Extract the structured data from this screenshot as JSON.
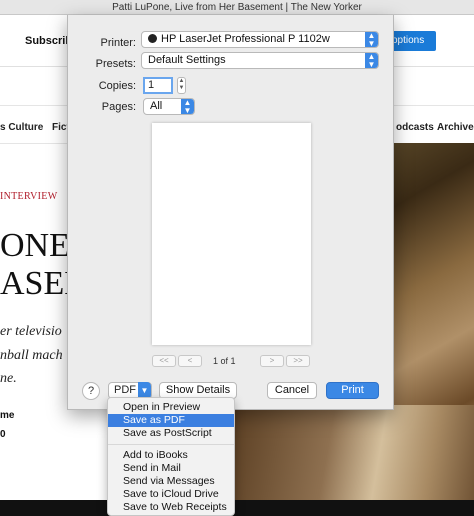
{
  "window": {
    "title": "Patti LuPone, Live from Her Basement | The New Yorker"
  },
  "webpage": {
    "subscribe_label": "Subscribe",
    "options_label": "options",
    "nav": {
      "left_item": "s Culture",
      "fict_item": "Ficti",
      "podcasts_item": "odcasts",
      "archive_item": "Archive"
    },
    "kicker": "INTERVIEW",
    "headline_line1": "ONE, I",
    "headline_line2": "ASEN",
    "dek_line1": "er televisio",
    "dek_line2": "nball mach",
    "dek_line3": "ne.",
    "byline_name": "me",
    "byline_date": "0"
  },
  "print_dialog": {
    "printer_label": "Printer:",
    "printer_value": "HP LaserJet Professional P 1102w",
    "presets_label": "Presets:",
    "presets_value": "Default Settings",
    "copies_label": "Copies:",
    "copies_value": "1",
    "pages_label": "Pages:",
    "pages_value": "All",
    "page_indicator": "1 of 1",
    "first_page_symbol": "<<",
    "prev_page_symbol": "<",
    "next_page_symbol": ">",
    "last_page_symbol": ">>",
    "help_symbol": "?",
    "pdf_label": "PDF",
    "show_details_label": "Show Details",
    "cancel_label": "Cancel",
    "print_label": "Print"
  },
  "pdf_menu": {
    "group1": [
      "Open in Preview",
      "Save as PDF",
      "Save as PostScript"
    ],
    "group2": [
      "Add to iBooks",
      "Send in Mail",
      "Send via Messages",
      "Save to iCloud Drive",
      "Save to Web Receipts"
    ],
    "selected": "Save as PDF"
  },
  "colors": {
    "accent": "#3b88e5",
    "kicker_red": "#b01d2b",
    "options_blue": "#1a7bd8"
  }
}
